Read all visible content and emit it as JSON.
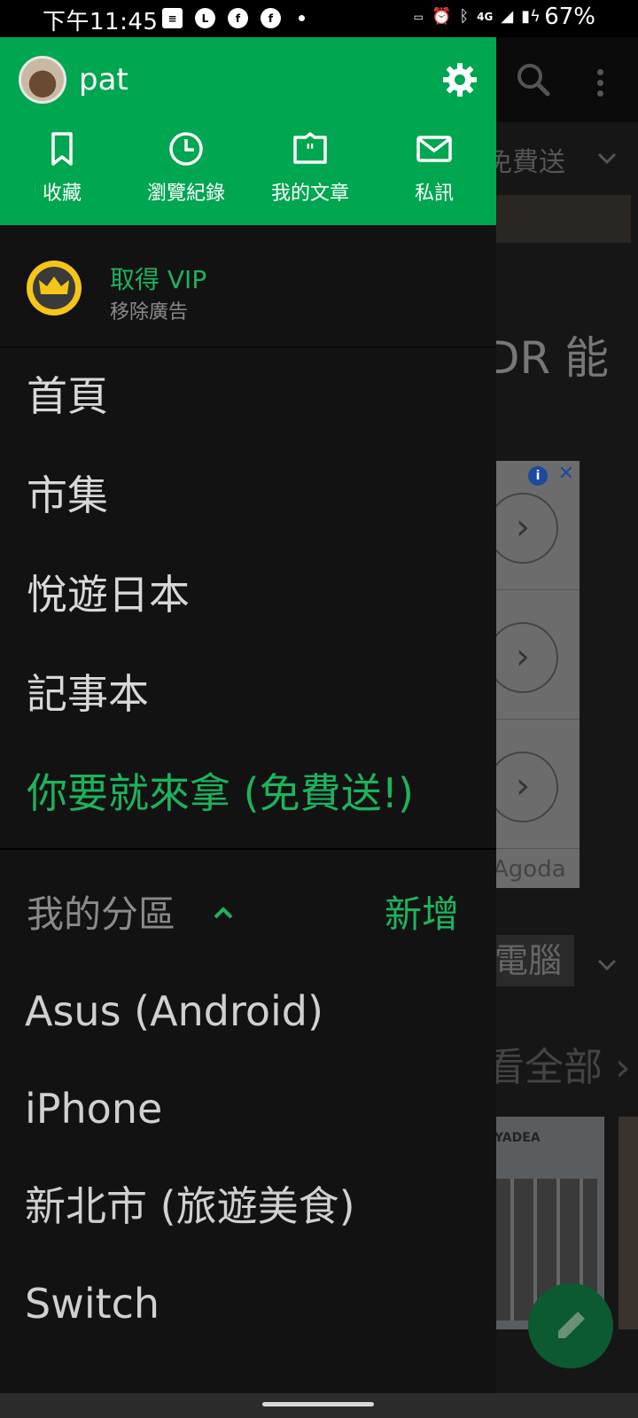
{
  "status_bar": {
    "time": "下午11:45",
    "network": "4G",
    "battery": "67%"
  },
  "background": {
    "tab_fragment": "免費送",
    "heading_fragment": "DR 能",
    "ad_brand": "Agoda",
    "category_fragment": "電腦",
    "see_all_fragment": "看全部 ›",
    "thumb_brand": "YADEA"
  },
  "drawer": {
    "user": {
      "name": "pat"
    },
    "quick_actions": [
      {
        "label": "收藏",
        "icon": "bookmark-icon"
      },
      {
        "label": "瀏覽紀錄",
        "icon": "history-clock-icon"
      },
      {
        "label": "我的文章",
        "icon": "my-articles-icon"
      },
      {
        "label": "私訊",
        "icon": "mail-icon"
      }
    ],
    "vip": {
      "title": "取得 VIP",
      "subtitle": "移除廣告"
    },
    "nav_items": [
      {
        "label": "首頁"
      },
      {
        "label": "市集"
      },
      {
        "label": "悅遊日本"
      },
      {
        "label": "記事本"
      },
      {
        "label": "你要就來拿 (免費送!)"
      }
    ],
    "my_sections": {
      "title": "我的分區",
      "add_label": "新增",
      "items": [
        {
          "label": "Asus (Android)"
        },
        {
          "label": "iPhone"
        },
        {
          "label": "新北市 (旅遊美食)"
        },
        {
          "label": "Switch"
        }
      ]
    }
  },
  "colors": {
    "header_green": "#00a650",
    "accent_green": "#1db35c",
    "drawer_bg": "#121212"
  }
}
